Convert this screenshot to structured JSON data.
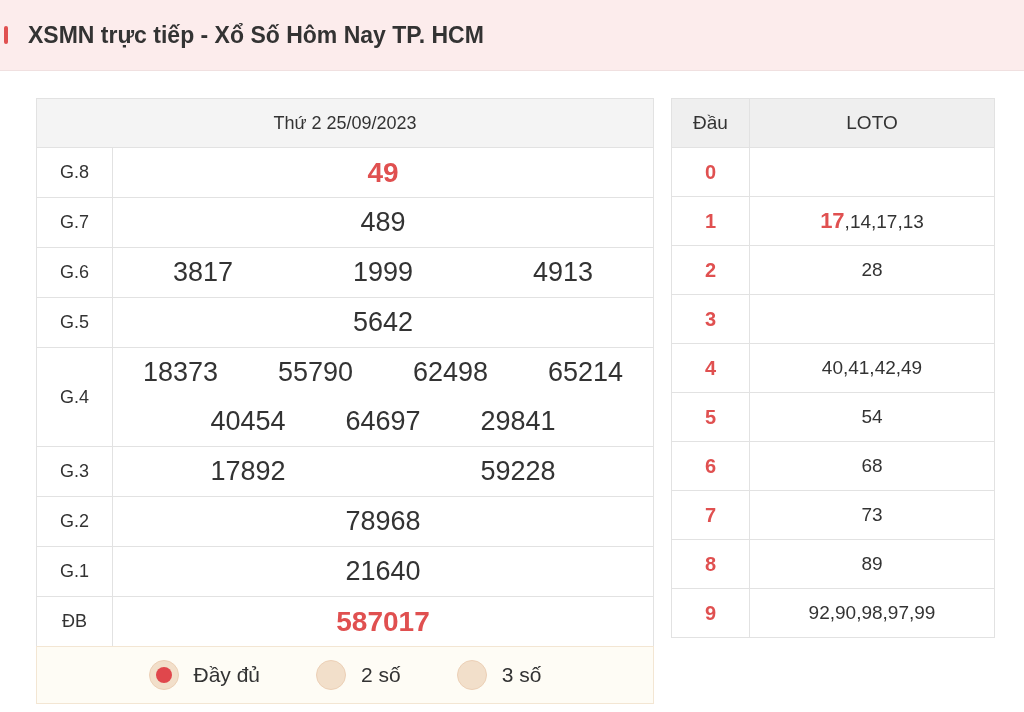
{
  "header": {
    "title": "XSMN trực tiếp - Xổ Số Hôm Nay TP. HCM"
  },
  "results": {
    "date": "Thứ 2 25/09/2023",
    "prizes": [
      {
        "label": "G.8",
        "kind": "special",
        "numbers": [
          "49"
        ]
      },
      {
        "label": "G.7",
        "kind": "normal",
        "numbers": [
          "489"
        ]
      },
      {
        "label": "G.6",
        "kind": "normal",
        "numbers": [
          "3817",
          "1999",
          "4913"
        ]
      },
      {
        "label": "G.5",
        "kind": "normal",
        "numbers": [
          "5642"
        ]
      },
      {
        "label": "G.4",
        "kind": "normal",
        "numbers": [
          "18373",
          "55790",
          "62498",
          "65214",
          "40454",
          "64697",
          "29841"
        ]
      },
      {
        "label": "G.3",
        "kind": "normal",
        "numbers": [
          "17892",
          "59228"
        ]
      },
      {
        "label": "G.2",
        "kind": "normal",
        "numbers": [
          "78968"
        ]
      },
      {
        "label": "G.1",
        "kind": "normal",
        "numbers": [
          "21640"
        ]
      },
      {
        "label": "ĐB",
        "kind": "special",
        "numbers": [
          "587017"
        ]
      }
    ],
    "options": [
      {
        "label": "Đầy đủ",
        "selected": true
      },
      {
        "label": "2 số",
        "selected": false
      },
      {
        "label": "3 số",
        "selected": false
      }
    ]
  },
  "loto": {
    "columns": [
      "Đầu",
      "LOTO"
    ],
    "rows": [
      {
        "head": "0",
        "values": ""
      },
      {
        "head": "1",
        "values": "**17**,14,17,13"
      },
      {
        "head": "2",
        "values": "28"
      },
      {
        "head": "3",
        "values": ""
      },
      {
        "head": "4",
        "values": "40,41,42,49"
      },
      {
        "head": "5",
        "values": "54"
      },
      {
        "head": "6",
        "values": "68"
      },
      {
        "head": "7",
        "values": "73"
      },
      {
        "head": "8",
        "values": "89"
      },
      {
        "head": "9",
        "values": "92,90,98,97,99"
      }
    ]
  }
}
